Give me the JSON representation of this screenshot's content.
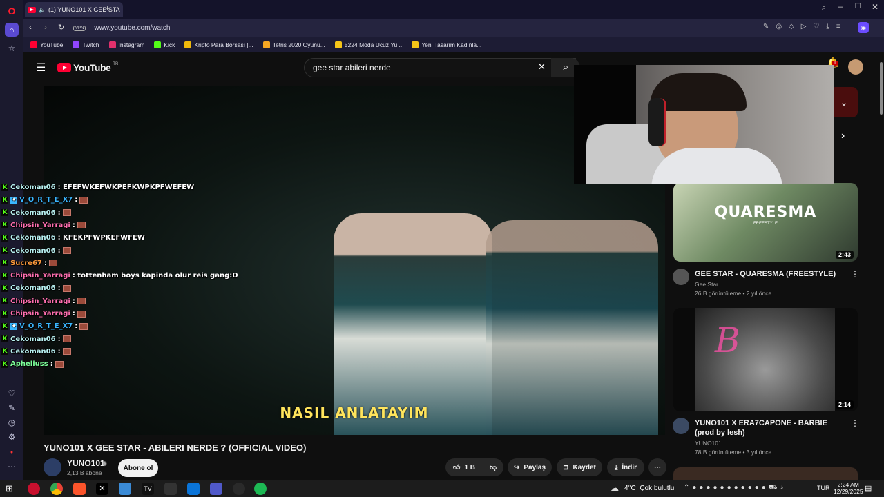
{
  "browser": {
    "tab_title": "(1) YUNO101 X GEE STA",
    "url": "www.youtube.com/watch",
    "vpn_label": "VPN",
    "bookmarks": [
      {
        "label": "YouTube",
        "color": "#ff0033"
      },
      {
        "label": "Twitch",
        "color": "#9146ff"
      },
      {
        "label": "Instagram",
        "color": "#e1306c"
      },
      {
        "label": "Kick",
        "color": "#53fc18"
      },
      {
        "label": "Kripto Para Borsası |...",
        "color": "#f0b90b"
      },
      {
        "label": "Tetris 2020 Oyunu...",
        "color": "#f5a623"
      },
      {
        "label": "5224 Moda Ucuz Yu...",
        "color": "#f5c518"
      },
      {
        "label": "Yeni Tasarım Kadınla...",
        "color": "#f5c518"
      }
    ]
  },
  "youtube": {
    "logo": "YouTube",
    "region": "TR",
    "search_query": "gee star abileri nerde",
    "notif_count": "1",
    "video": {
      "subtitle": "NASIL ANLATAYIM",
      "title": "YUNO101 X GEE STAR - ABILERI NERDE ? (OFFICIAL VIDEO)",
      "channel": "YUNO101",
      "subscribers": "2,13 B abone",
      "subscribe_label": "Abone ol",
      "likes": "1 B",
      "share_label": "Paylaş",
      "save_label": "Kaydet",
      "download_label": "İndir"
    },
    "recommendations": [
      {
        "thumb_text": "QUARESMA",
        "thumb_sub": "FREESTYLE",
        "duration": "2:43",
        "title": "GEE STAR - QUARESMA (FREESTYLE)",
        "channel": "Gee Star",
        "meta": "26 B görüntüleme • 2 yıl önce"
      },
      {
        "duration": "2:14",
        "title": "YUNO101 X ERA7CAPONE - BARBIE (prod by lesh)",
        "channel": "YUNO101",
        "meta": "78 B görüntüleme • 3 yıl önce"
      }
    ]
  },
  "chat": [
    {
      "user": "Cekoman06",
      "msg": ": EFEFWKEFWKPEFKWPKPFWEFEW",
      "color": "#b8f0f0",
      "emote": false,
      "vortex": false
    },
    {
      "user": "V_O_R_T_E_X7",
      "msg": ":",
      "color": "#3ab6ff",
      "emote": true,
      "vortex": true
    },
    {
      "user": "Cekoman06",
      "msg": ":",
      "color": "#b8f0f0",
      "emote": true,
      "vortex": false
    },
    {
      "user": "Chipsin_Yarragi",
      "msg": ":",
      "color": "#ff6fb0",
      "emote": true,
      "vortex": false
    },
    {
      "user": "Cekoman06",
      "msg": ": KFEKPFWPKEFWFEW",
      "color": "#b8f0f0",
      "emote": false,
      "vortex": false
    },
    {
      "user": "Cekoman06",
      "msg": ":",
      "color": "#b8f0f0",
      "emote": true,
      "vortex": false
    },
    {
      "user": "Sucre67",
      "msg": ":",
      "color": "#ff9a3c",
      "emote": true,
      "vortex": false
    },
    {
      "user": "Chipsin_Yarragi",
      "msg": ": tottenham boys kapinda olur reis gang:D",
      "color": "#ff6fb0",
      "emote": false,
      "vortex": false
    },
    {
      "user": "Cekoman06",
      "msg": ":",
      "color": "#b8f0f0",
      "emote": true,
      "vortex": false
    },
    {
      "user": "Chipsin_Yarragi",
      "msg": ":",
      "color": "#ff6fb0",
      "emote": true,
      "vortex": false
    },
    {
      "user": "Chipsin_Yarragi",
      "msg": ":",
      "color": "#ff6fb0",
      "emote": true,
      "vortex": false
    },
    {
      "user": "V_O_R_T_E_X7",
      "msg": ":",
      "color": "#3ab6ff",
      "emote": true,
      "vortex": true
    },
    {
      "user": "Cekoman06",
      "msg": ":",
      "color": "#b8f0f0",
      "emote": true,
      "vortex": false
    },
    {
      "user": "Cekoman06",
      "msg": ":",
      "color": "#b8f0f0",
      "emote": true,
      "vortex": false
    },
    {
      "user": "Apheliuss",
      "msg": ":",
      "color": "#7dff9a",
      "emote": true,
      "vortex": false
    }
  ],
  "taskbar": {
    "weather": "4°C  Çok bulutlu",
    "lang": "TUR",
    "time": "2:24 AM",
    "date": "12/29/2025"
  }
}
